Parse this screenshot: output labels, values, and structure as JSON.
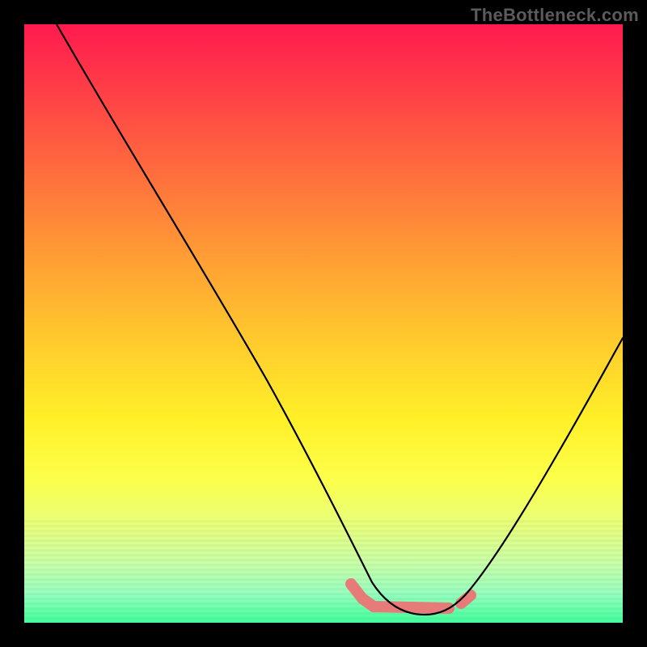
{
  "watermark": "TheBottleneck.com",
  "colors": {
    "coral": "#e77b7a",
    "curve": "#000000",
    "gradient_top": "#ff1a4f",
    "gradient_bottom": "#42ff9c"
  },
  "chart_data": {
    "type": "line",
    "title": "",
    "xlabel": "",
    "ylabel": "",
    "xlim": [
      0,
      100
    ],
    "ylim": [
      0,
      100
    ],
    "grid": false,
    "legend": false,
    "series": [
      {
        "name": "bottleneck-curve",
        "x": [
          6,
          15,
          25,
          35,
          45,
          52,
          57,
          60,
          63,
          66,
          69,
          72,
          76,
          82,
          90,
          100
        ],
        "values": [
          100,
          86,
          70,
          54,
          36,
          22,
          12,
          6,
          2,
          1,
          1,
          3,
          7,
          16,
          30,
          50
        ]
      }
    ],
    "annotations": [
      {
        "name": "optimal-range-marker",
        "shape": "flat-stroke",
        "x_from": 56,
        "x_to": 74,
        "y": 2,
        "color": "#e77b7a"
      }
    ]
  }
}
